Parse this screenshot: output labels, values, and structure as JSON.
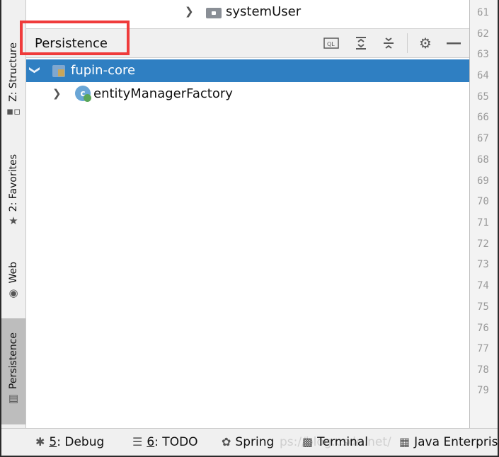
{
  "left_tabs": [
    {
      "label": "Z: Structure",
      "icon": "structure-icon"
    },
    {
      "label": "2: Favorites",
      "icon": "star-icon"
    },
    {
      "label": "Web",
      "icon": "web-icon"
    },
    {
      "label": "Persistence",
      "icon": "persistence-icon",
      "active": true
    }
  ],
  "top_row": {
    "name": "systemUser",
    "icon": "folder-icon"
  },
  "panel": {
    "title": "Persistence"
  },
  "toolbar": [
    "ql-console-icon",
    "expand-all-icon",
    "collapse-all-icon",
    "gear-icon",
    "minimize-icon"
  ],
  "tree": [
    {
      "label": "fupin-core",
      "icon": "module-icon",
      "selected": true
    },
    {
      "label": "entityManagerFactory",
      "icon": "bean-icon",
      "bean_letter": "c"
    }
  ],
  "gutter_lines": [
    "61",
    "62",
    "63",
    "64",
    "65",
    "66",
    "67",
    "68",
    "69",
    "70",
    "71",
    "72",
    "73",
    "74",
    "75",
    "76",
    "77",
    "78",
    "79"
  ],
  "bottom_tabs": [
    {
      "key": "5",
      "label": ": Debug",
      "icon": "debug-icon"
    },
    {
      "key": "6",
      "label": ": TODO",
      "icon": "todo-icon"
    },
    {
      "key": "",
      "label": "Spring",
      "icon": "spring-icon"
    },
    {
      "key": "",
      "label": "Terminal",
      "icon": "terminal-icon"
    },
    {
      "key": "",
      "label": "Java Enterpris",
      "icon": "java-enterprise-icon"
    }
  ],
  "watermark": "ps://blog.csdn.net/"
}
